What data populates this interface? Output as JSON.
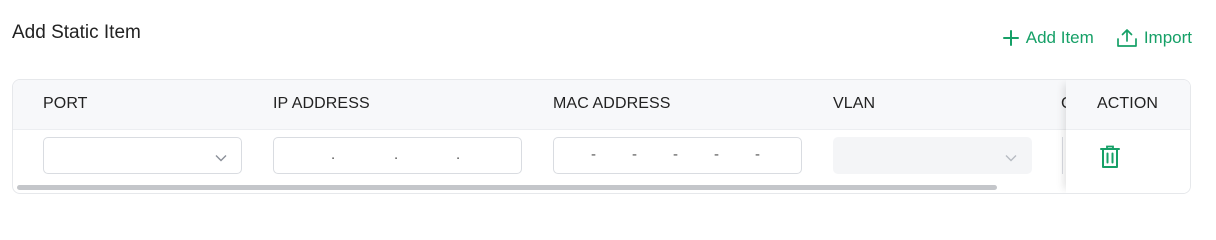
{
  "header": {
    "title": "Add Static Item",
    "add_item_label": "Add Item",
    "import_label": "Import"
  },
  "table": {
    "columns": [
      "PORT",
      "IP ADDRESS",
      "MAC ADDRESS",
      "VLAN"
    ],
    "action_header": "ACTION",
    "row": {
      "port_value": "",
      "ip_separators": [
        ".",
        ".",
        "."
      ],
      "mac_separators": [
        "-",
        "-",
        "-",
        "-",
        "-"
      ],
      "vlan_value": ""
    }
  },
  "colors": {
    "accent": "#16a067",
    "header_bg": "#f7f8fa",
    "border": "#d9dce1"
  },
  "icons": {
    "add": "plus-icon",
    "import": "upload-icon",
    "delete": "trash-icon",
    "dropdown": "chevron-down-icon"
  }
}
